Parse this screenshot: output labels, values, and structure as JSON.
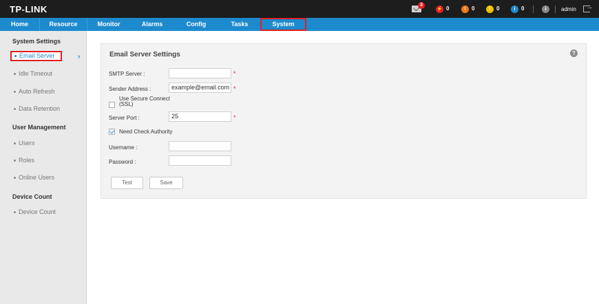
{
  "header": {
    "logo": "TP-LINK",
    "mail_badge": "3",
    "alarms": [
      {
        "name": "critical",
        "count": "0",
        "color": "#e02020",
        "glyph": "⚡"
      },
      {
        "name": "major",
        "count": "0",
        "color": "#f07818",
        "glyph": "!"
      },
      {
        "name": "minor",
        "count": "0",
        "color": "#f0c000",
        "glyph": "!"
      },
      {
        "name": "info",
        "count": "0",
        "color": "#1e8ace",
        "glyph": "i"
      }
    ],
    "user": "admin"
  },
  "nav": {
    "tabs": [
      "Home",
      "Resource",
      "Monitor",
      "Alarms",
      "Config",
      "Tasks",
      "System"
    ],
    "active": "System"
  },
  "sidebar": {
    "sections": [
      {
        "title": "System Settings",
        "items": [
          "Email Server",
          "Idle Timeout",
          "Auto Refresh",
          "Data Retention"
        ]
      },
      {
        "title": "User Management",
        "items": [
          "Users",
          "Roles",
          "Online Users"
        ]
      },
      {
        "title": "Device Count",
        "items": [
          "Device Count"
        ]
      }
    ],
    "active_item": "Email Server"
  },
  "form": {
    "title": "Email Server Settings",
    "smtp_label": "SMTP Server :",
    "smtp_value": "",
    "sender_label": "Sender Address :",
    "sender_value": "example@email.com",
    "ssl_label_line1": "Use Secure Connect",
    "ssl_label_line2": "(SSL)",
    "ssl_checked": false,
    "port_label": "Server Port :",
    "port_value": "25",
    "auth_label": "Need Check Authority",
    "auth_checked": true,
    "username_label": "Username :",
    "username_value": "",
    "password_label": "Password :",
    "password_value": "",
    "required_mark": "*",
    "test_label": "Test",
    "save_label": "Save"
  },
  "colors": {
    "accent": "#1e8ace",
    "highlight": "#e02020",
    "topbar": "#1d1d1d"
  }
}
